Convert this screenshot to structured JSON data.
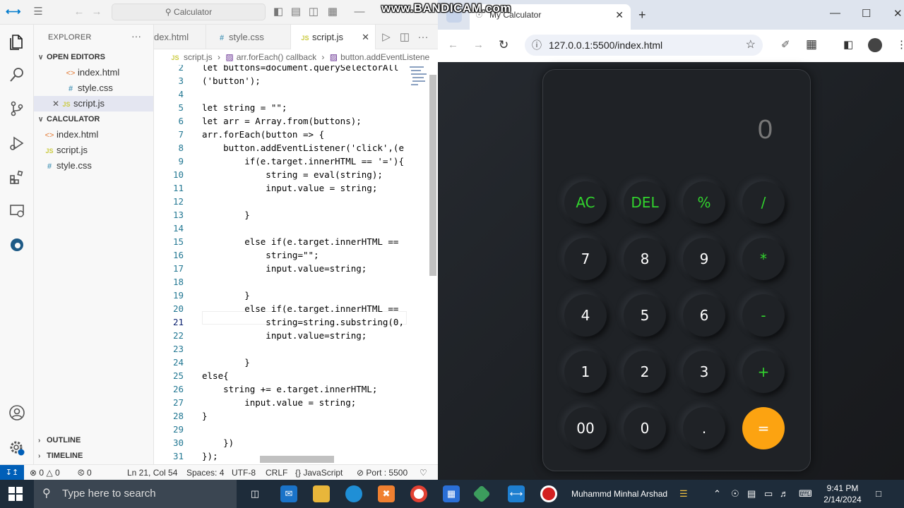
{
  "vscode": {
    "search_placeholder": "Calculator",
    "explorer_label": "EXPLORER",
    "more_label": "···",
    "open_editors_label": "OPEN EDITORS",
    "project_label": "CALCULATOR",
    "open_editors": [
      {
        "name": "index.html",
        "type": "html"
      },
      {
        "name": "style.css",
        "type": "css"
      },
      {
        "name": "script.js",
        "type": "js"
      }
    ],
    "files": [
      {
        "name": "index.html",
        "type": "html"
      },
      {
        "name": "script.js",
        "type": "js"
      },
      {
        "name": "style.css",
        "type": "css"
      }
    ],
    "tabs": [
      {
        "label": "dex.html"
      },
      {
        "label": "style.css"
      },
      {
        "label": "script.js"
      }
    ],
    "breadcrumb": [
      "script.js",
      "arr.forEach() callback",
      "button.addEventListene"
    ],
    "code_lines": [
      {
        "n": "2",
        "text": "let buttons=document.querySelectorAll"
      },
      {
        "n": "3",
        "text": "('button');"
      },
      {
        "n": "4",
        "text": ""
      },
      {
        "n": "5",
        "text": "let string = \"\";"
      },
      {
        "n": "6",
        "text": "let arr = Array.from(buttons);"
      },
      {
        "n": "7",
        "text": "arr.forEach(button => {"
      },
      {
        "n": "8",
        "text": "    button.addEventListener('click',(e"
      },
      {
        "n": "9",
        "text": "        if(e.target.innerHTML == '='){"
      },
      {
        "n": "10",
        "text": "            string = eval(string);"
      },
      {
        "n": "11",
        "text": "            input.value = string;"
      },
      {
        "n": "12",
        "text": ""
      },
      {
        "n": "13",
        "text": "        }"
      },
      {
        "n": "14",
        "text": ""
      },
      {
        "n": "15",
        "text": "        else if(e.target.innerHTML =="
      },
      {
        "n": "16",
        "text": "            string=\"\";"
      },
      {
        "n": "17",
        "text": "            input.value=string;"
      },
      {
        "n": "18",
        "text": ""
      },
      {
        "n": "19",
        "text": "        }"
      },
      {
        "n": "20",
        "text": "        else if(e.target.innerHTML =="
      },
      {
        "n": "21",
        "text": "            string=string.substring(0,"
      },
      {
        "n": "22",
        "text": "            input.value=string;"
      },
      {
        "n": "23",
        "text": ""
      },
      {
        "n": "24",
        "text": "        }"
      },
      {
        "n": "25",
        "text": "else{"
      },
      {
        "n": "26",
        "text": "    string += e.target.innerHTML;"
      },
      {
        "n": "27",
        "text": "        input.value = string;"
      },
      {
        "n": "28",
        "text": "}"
      },
      {
        "n": "29",
        "text": ""
      },
      {
        "n": "30",
        "text": "    })"
      },
      {
        "n": "31",
        "text": "});"
      }
    ],
    "current_line": "21",
    "outline_label": "OUTLINE",
    "timeline_label": "TIMELINE",
    "status": {
      "errors": "0",
      "warnings": "0",
      "ports": "0",
      "position": "Ln 21, Col 54",
      "spaces": "Spaces: 4",
      "encoding": "UTF-8",
      "eol": "CRLF",
      "language": "JavaScript",
      "port": "Port : 5500"
    }
  },
  "chrome": {
    "tab_title": "My Calculator",
    "url": "127.0.0.1:5500/index.html",
    "calculator": {
      "display_value": "0",
      "buttons": [
        {
          "label": "AC",
          "kind": "op"
        },
        {
          "label": "DEL",
          "kind": "op"
        },
        {
          "label": "%",
          "kind": "op"
        },
        {
          "label": "/",
          "kind": "op"
        },
        {
          "label": "7",
          "kind": "num"
        },
        {
          "label": "8",
          "kind": "num"
        },
        {
          "label": "9",
          "kind": "num"
        },
        {
          "label": "*",
          "kind": "op"
        },
        {
          "label": "4",
          "kind": "num"
        },
        {
          "label": "5",
          "kind": "num"
        },
        {
          "label": "6",
          "kind": "num"
        },
        {
          "label": "-",
          "kind": "op"
        },
        {
          "label": "1",
          "kind": "num"
        },
        {
          "label": "2",
          "kind": "num"
        },
        {
          "label": "3",
          "kind": "num"
        },
        {
          "label": "+",
          "kind": "op"
        },
        {
          "label": "00",
          "kind": "num"
        },
        {
          "label": "0",
          "kind": "num"
        },
        {
          "label": ".",
          "kind": "num"
        },
        {
          "label": "=",
          "kind": "eq"
        }
      ],
      "colors": {
        "accent": "#32d42e",
        "equals": "#fca311",
        "body": "#1f2226"
      }
    }
  },
  "watermark": "www.BANDICAM.com",
  "taskbar": {
    "search_placeholder": "Type here to search",
    "user": "Muhammd Minhal Arshad",
    "time": "9:41 PM",
    "date": "2/14/2024"
  }
}
